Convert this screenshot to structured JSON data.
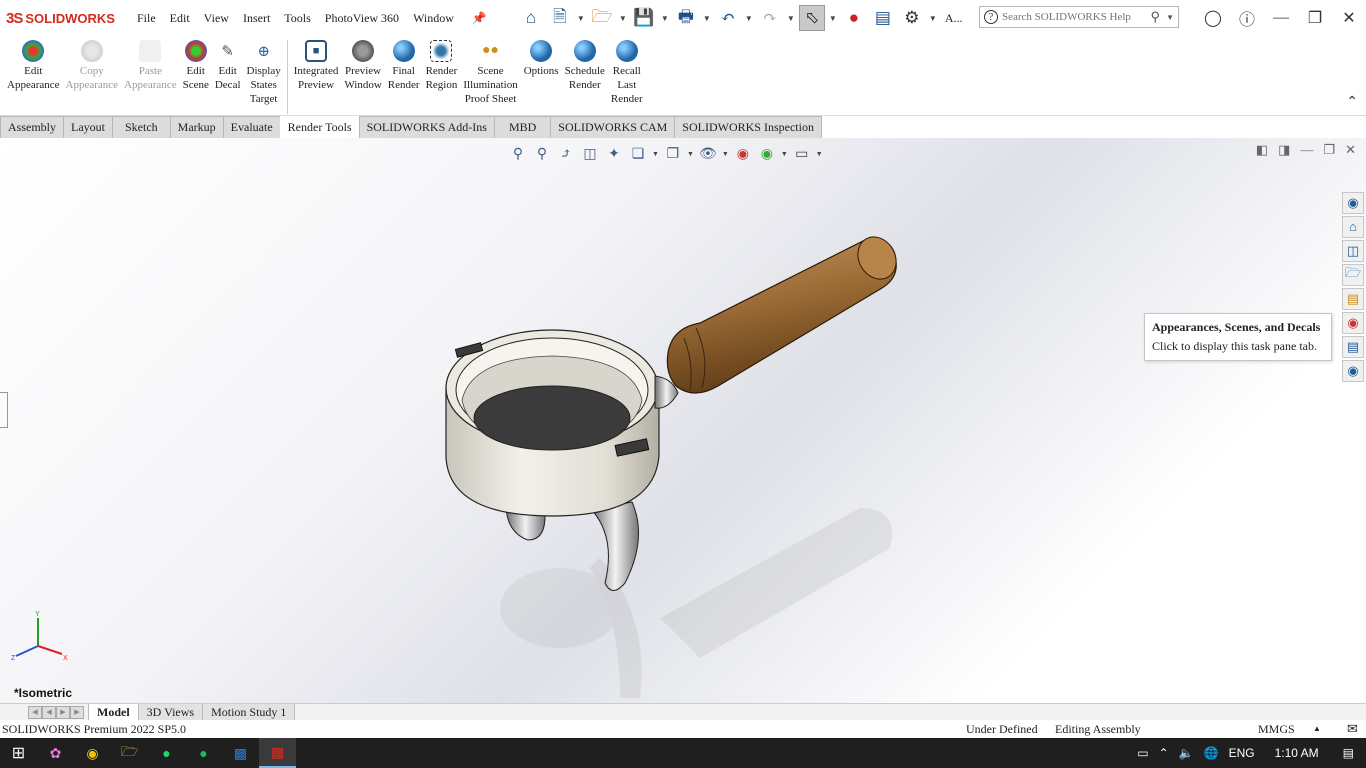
{
  "app": {
    "logo_ds": "3S",
    "brand": "SOLIDWORKS"
  },
  "menus": [
    "File",
    "Edit",
    "View",
    "Insert",
    "Tools",
    "PhotoView 360",
    "Window"
  ],
  "quickbar": {
    "overflow_label": "A..."
  },
  "search": {
    "placeholder": "Search SOLIDWORKS Help"
  },
  "commands": [
    {
      "label": "Edit\nAppearance",
      "enabled": true
    },
    {
      "label": "Copy\nAppearance",
      "enabled": false
    },
    {
      "label": "Paste\nAppearance",
      "enabled": false
    },
    {
      "label": "Edit\nScene",
      "enabled": true
    },
    {
      "label": "Edit\nDecal",
      "enabled": true
    },
    {
      "label": "Display\nStates\nTarget",
      "enabled": true
    },
    {
      "label": "Integrated\nPreview",
      "enabled": true
    },
    {
      "label": "Preview\nWindow",
      "enabled": true
    },
    {
      "label": "Final\nRender",
      "enabled": true
    },
    {
      "label": "Render\nRegion",
      "enabled": true
    },
    {
      "label": "Scene\nIllumination\nProof Sheet",
      "enabled": true
    },
    {
      "label": "Options",
      "enabled": true
    },
    {
      "label": "Schedule\nRender",
      "enabled": true
    },
    {
      "label": "Recall\nLast\nRender",
      "enabled": true
    }
  ],
  "tabs": [
    "Assembly",
    "Layout",
    "Sketch",
    "Markup",
    "Evaluate",
    "Render Tools",
    "SOLIDWORKS Add-Ins",
    "MBD",
    "SOLIDWORKS CAM",
    "SOLIDWORKS Inspection"
  ],
  "active_tab": "Render Tools",
  "tooltip": {
    "title": "Appearances, Scenes, and Decals",
    "body": "Click to display this task pane tab."
  },
  "triad": {
    "x": "X",
    "y": "Y",
    "z": "Z"
  },
  "view_label": "*Isometric",
  "bottom_tabs": [
    "Model",
    "3D Views",
    "Motion Study 1"
  ],
  "active_bottom_tab": "Model",
  "status": {
    "version": "SOLIDWORKS Premium 2022 SP5.0",
    "definition": "Under Defined",
    "mode": "Editing Assembly",
    "units": "MMGS"
  },
  "taskbar": {
    "language": "ENG",
    "time": "1:10 AM"
  },
  "colors": {
    "brand_red": "#d52b1e",
    "handle_wood": "#9a6a34",
    "metal": "#e8e6df",
    "taskbar": "#1f1f1f"
  }
}
